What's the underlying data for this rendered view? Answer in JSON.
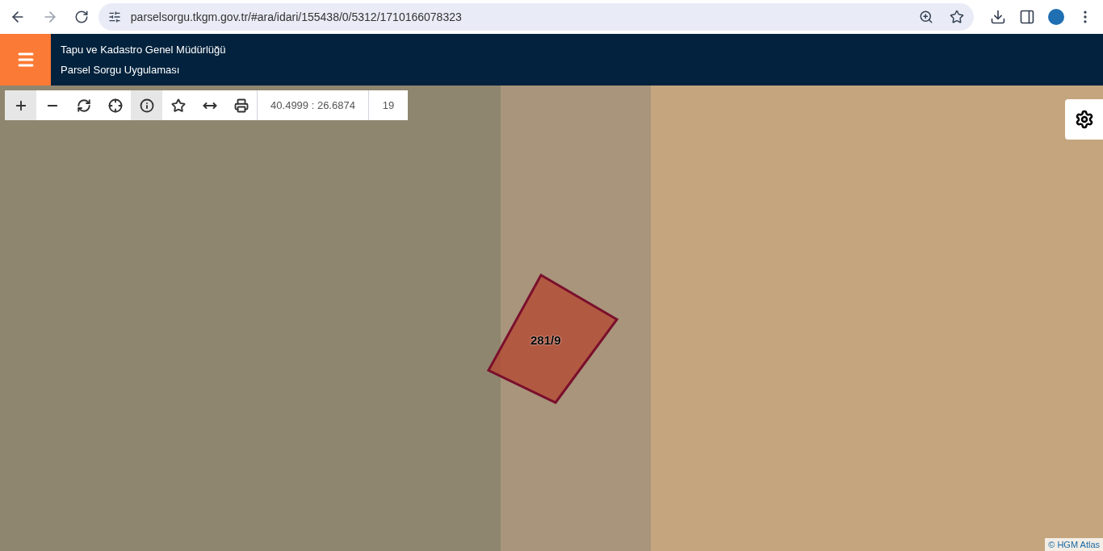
{
  "browser": {
    "url": "parselsorgu.tkgm.gov.tr/#ara/idari/155438/0/5312/1710166078323"
  },
  "header": {
    "title": "Tapu ve Kadastro Genel Müdürlüğü",
    "subtitle": "Parsel Sorgu Uygulaması"
  },
  "toolbar": {
    "tools": [
      {
        "kind": "plus",
        "selected": true
      },
      {
        "kind": "minus",
        "selected": false
      },
      {
        "kind": "refresh",
        "selected": false
      },
      {
        "kind": "locate",
        "selected": false
      },
      {
        "kind": "info",
        "selected": true
      },
      {
        "kind": "star",
        "selected": false
      },
      {
        "kind": "measure",
        "selected": false
      },
      {
        "kind": "print",
        "selected": false
      }
    ],
    "coordinates": "40.4999 : 26.6874",
    "zoom": "19"
  },
  "map": {
    "parcel_label": "281/9",
    "attribution": "© HGM Atlas"
  }
}
